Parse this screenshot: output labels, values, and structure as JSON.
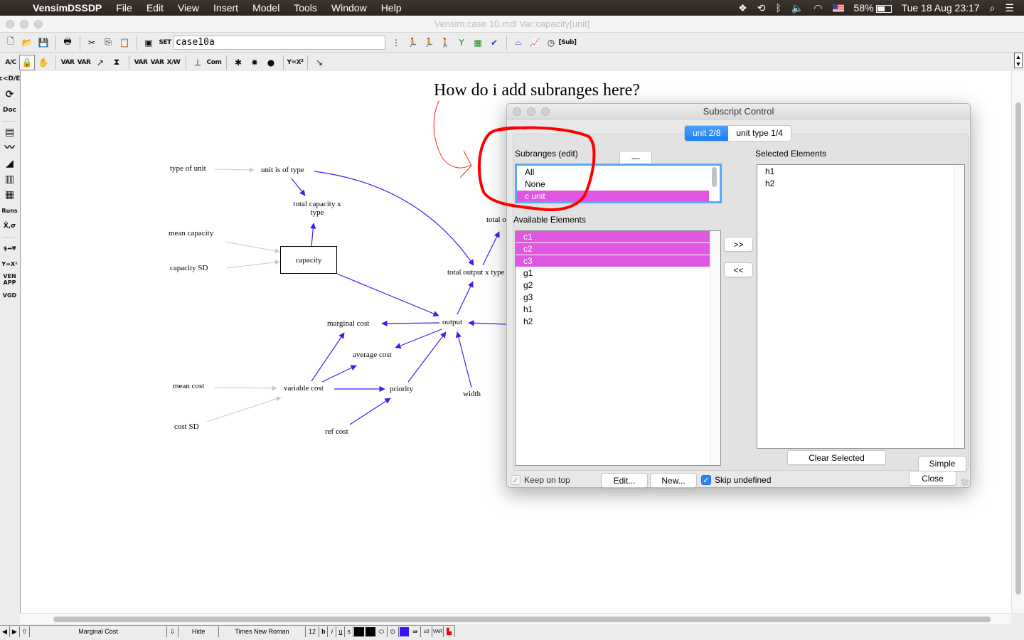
{
  "menubar": {
    "app_name": "VensimDSSDP",
    "items": [
      "File",
      "Edit",
      "View",
      "Insert",
      "Model",
      "Tools",
      "Window",
      "Help"
    ],
    "status": {
      "battery": "58%",
      "datetime": "Tue 18 Aug  23:17"
    }
  },
  "window": {
    "title": "Vensim:case 10.mdl Var:capacity[unit]"
  },
  "toolbar1": {
    "run_name": "case10a",
    "icons": [
      "new-model",
      "open-model",
      "save",
      "print",
      "cut",
      "copy",
      "paste",
      "control-panel",
      "set-run",
      "simulate",
      "synthesim",
      "gaming",
      "reality-check",
      "sensitivity",
      "optimize",
      "causal-tracing",
      "output-graph",
      "analysis",
      "subscript-control"
    ],
    "subscript_label": "[Sub]",
    "set_label": "SET"
  },
  "toolbar2": {
    "tools": [
      {
        "name": "abc",
        "glyph": "A/C"
      },
      {
        "name": "lock",
        "glyph": "🔒"
      },
      {
        "name": "hand",
        "glyph": "✋"
      },
      {
        "name": "variable",
        "glyph": "VAR"
      },
      {
        "name": "box-variable",
        "glyph": "VAR"
      },
      {
        "name": "arrow",
        "glyph": "↗"
      },
      {
        "name": "rate",
        "glyph": "⧗"
      },
      {
        "name": "shadow-variable",
        "glyph": "VAR"
      },
      {
        "name": "input-output",
        "glyph": "VAR"
      },
      {
        "name": "model-var",
        "glyph": "X/W"
      },
      {
        "name": "comment",
        "glyph": "Com"
      },
      {
        "name": "delete",
        "glyph": "✱"
      },
      {
        "name": "equations",
        "glyph": "✸"
      },
      {
        "name": "reference-mode",
        "glyph": "●"
      },
      {
        "name": "units",
        "glyph": "Y=X²"
      },
      {
        "name": "sketch-option",
        "glyph": "↘"
      }
    ]
  },
  "leftbar": {
    "tools": [
      {
        "name": "causes-tree",
        "glyph": "c<D/E"
      },
      {
        "name": "loops",
        "glyph": "⟳"
      },
      {
        "name": "document",
        "glyph": "Doc"
      },
      {
        "name": "causes-strip",
        "glyph": "▤"
      },
      {
        "name": "graph",
        "glyph": "〰"
      },
      {
        "name": "sensitivity-graph",
        "glyph": "◢"
      },
      {
        "name": "bar-graph",
        "glyph": "▥"
      },
      {
        "name": "table",
        "glyph": "▦"
      },
      {
        "name": "runs-compare",
        "glyph": "Runs"
      },
      {
        "name": "statistics",
        "glyph": "X̄,σ"
      },
      {
        "name": "units-check",
        "glyph": "$↔¥"
      },
      {
        "name": "equation-check",
        "glyph": "Y=X²"
      },
      {
        "name": "venapp",
        "glyph": "VEN APP"
      },
      {
        "name": "vgd",
        "glyph": "VGD"
      }
    ]
  },
  "diagram": {
    "question": "How do i add subranges here?",
    "variables": {
      "type_of_unit": "type of unit",
      "unit_is_of_type": "unit is of type",
      "total_capacity_x_type_1": "total capacity x",
      "total_capacity_x_type_2": "type",
      "mean_capacity": "mean capacity",
      "capacity_sd": "capacity SD",
      "capacity": "capacity",
      "total_output_x_type": "total output x type",
      "total_o": "total o",
      "marginal_cost": "marginal cost",
      "output": "output",
      "average_cost": "average cost",
      "mean_cost": "mean cost",
      "variable_cost": "variable cost",
      "priority": "priority",
      "width": "width",
      "cost_sd": "cost SD",
      "ref_cost": "ref cost"
    },
    "colors": {
      "link": "#3a1ff2",
      "shadow_link": "#c8c8c8",
      "annotation": "#ff0000"
    }
  },
  "dialog": {
    "title": "Subscript Control",
    "tabs": [
      {
        "label": "unit  2/8",
        "selected": true
      },
      {
        "label": "unit type  1/4",
        "selected": false
      }
    ],
    "subranges": {
      "label": "Subranges (edit)",
      "dash_button": "---",
      "items": [
        {
          "label": "All",
          "selected": false
        },
        {
          "label": "None",
          "selected": false
        },
        {
          "label": "c unit",
          "selected": true
        }
      ]
    },
    "available": {
      "label": "Available Elements",
      "items": [
        {
          "label": "c1",
          "selected": true
        },
        {
          "label": "c2",
          "selected": true
        },
        {
          "label": "c3",
          "selected": true
        },
        {
          "label": "g1",
          "selected": false
        },
        {
          "label": "g2",
          "selected": false
        },
        {
          "label": "g3",
          "selected": false
        },
        {
          "label": "h1",
          "selected": false
        },
        {
          "label": "h2",
          "selected": false
        }
      ]
    },
    "selected": {
      "label": "Selected Elements",
      "items": [
        "h1",
        "h2"
      ]
    },
    "buttons": {
      "add": ">>",
      "remove": "<<",
      "clear_selected": "Clear Selected",
      "simple": "Simple",
      "edit": "Edit...",
      "new": "New...",
      "close": "Close"
    },
    "checkboxes": {
      "keep_on_top": {
        "label": "Keep on top",
        "checked": true,
        "enabled": false
      },
      "skip_undefined": {
        "label": "Skip undefined",
        "checked": true,
        "enabled": true
      }
    },
    "selection_color": "#df57e0"
  },
  "statusbar": {
    "variable": "Marginal Cost",
    "hide": "Hide",
    "font": "Times New Roman",
    "font_size": "12",
    "bold": "b",
    "italic": "i",
    "underline": "u",
    "strike": "s",
    "colors": {
      "text": "#000000",
      "border": "#000000",
      "fill": "#3a10ff"
    }
  }
}
